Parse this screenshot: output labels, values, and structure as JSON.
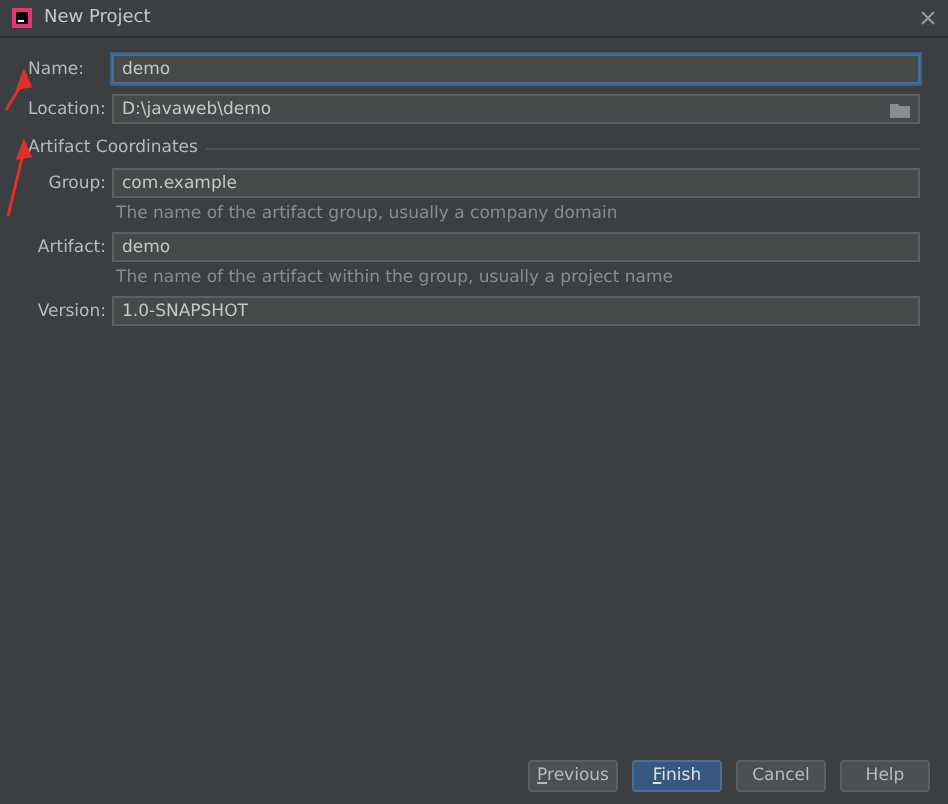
{
  "window": {
    "title": "New Project"
  },
  "fields": [
    {
      "label": "Name:",
      "value": "demo",
      "focused": true,
      "browse": false
    },
    {
      "label": "Location:",
      "value": "D:\\javaweb\\demo",
      "focused": false,
      "browse": true
    }
  ],
  "artifact_coordinates": {
    "title": "Artifact Coordinates",
    "fields": [
      {
        "label": "Group:",
        "value": "com.example",
        "hint": "The name of the artifact group, usually a company domain"
      },
      {
        "label": "Artifact:",
        "value": "demo",
        "hint": "The name of the artifact within the group, usually a project name"
      },
      {
        "label": "Version:",
        "value": "1.0-SNAPSHOT"
      }
    ]
  },
  "buttons": [
    {
      "label": "Previous",
      "underline_first": true,
      "default": false
    },
    {
      "label": "Finish",
      "underline_first": true,
      "default": true
    },
    {
      "label": "Cancel",
      "underline_first": false,
      "default": false
    },
    {
      "label": "Help",
      "underline_first": false,
      "default": false
    }
  ]
}
